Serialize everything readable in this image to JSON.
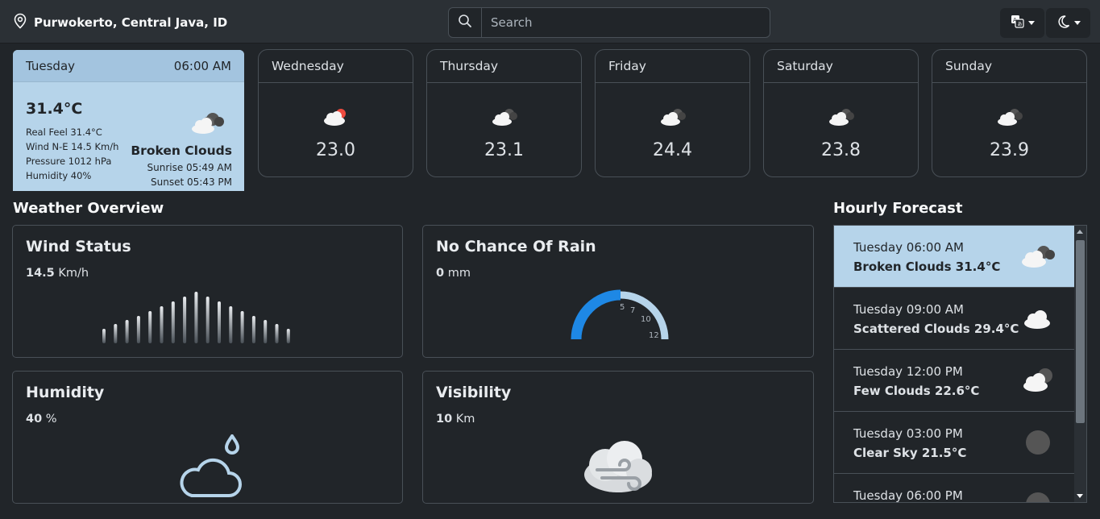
{
  "header": {
    "location": "Purwokerto, Central Java, ID",
    "search_placeholder": "Search",
    "translate_icon": "translate-icon",
    "theme_icon": "moon-icon"
  },
  "today": {
    "day": "Tuesday",
    "time": "06:00 AM",
    "temp": "31.4°C",
    "real_feel": "Real Feel 31.4°C",
    "wind": "Wind N-E 14.5 Km/h",
    "pressure": "Pressure 1012 hPa",
    "humidity": "Humidity 40%",
    "description": "Broken Clouds",
    "sunrise": "Sunrise 05:49 AM",
    "sunset": "Sunset 05:43 PM",
    "icon": "broken-clouds-icon"
  },
  "forecast": [
    {
      "day": "Wednesday",
      "temp": "23.0",
      "icon": "cloud-sun-icon"
    },
    {
      "day": "Thursday",
      "temp": "23.1",
      "icon": "broken-clouds-icon"
    },
    {
      "day": "Friday",
      "temp": "24.4",
      "icon": "broken-clouds-icon"
    },
    {
      "day": "Saturday",
      "temp": "23.8",
      "icon": "broken-clouds-icon"
    },
    {
      "day": "Sunday",
      "temp": "23.9",
      "icon": "broken-clouds-icon"
    }
  ],
  "overview": {
    "title": "Weather Overview",
    "wind": {
      "title": "Wind Status",
      "value": "14.5",
      "unit": " Km/h"
    },
    "rain": {
      "title": "No Chance Of Rain",
      "value": "0",
      "unit": " mm",
      "gauge_labels": [
        "5",
        "7",
        "10",
        "12"
      ],
      "level": 0.5
    },
    "humidity": {
      "title": "Humidity",
      "value": "40",
      "unit": " %"
    },
    "visibility": {
      "title": "Visibility",
      "value": "10",
      "unit": " Km"
    }
  },
  "hourly": {
    "title": "Hourly Forecast",
    "items": [
      {
        "time": "Tuesday 06:00 AM",
        "desc": "Broken Clouds 31.4°C",
        "icon": "broken-clouds-icon"
      },
      {
        "time": "Tuesday 09:00 AM",
        "desc": "Scattered Clouds 29.4°C",
        "icon": "cloud-icon"
      },
      {
        "time": "Tuesday 12:00 PM",
        "desc": "Few Clouds 22.6°C",
        "icon": "few-clouds-icon"
      },
      {
        "time": "Tuesday 03:00 PM",
        "desc": "Clear Sky 21.5°C",
        "icon": "moon-icon"
      },
      {
        "time": "Tuesday 06:00 PM",
        "desc": "",
        "icon": "moon-icon"
      }
    ]
  },
  "colors": {
    "accent": "#b6d4ea",
    "gauge": "#1e88e5",
    "background": "#212529"
  }
}
